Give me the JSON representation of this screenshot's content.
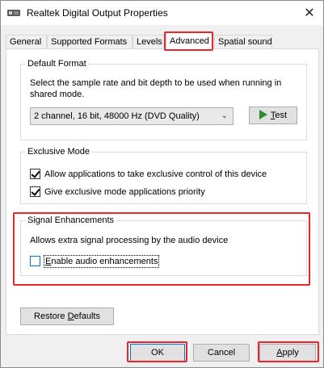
{
  "window": {
    "title": "Realtek Digital Output Properties",
    "close_glyph": "✕"
  },
  "tabs": [
    {
      "label": "General"
    },
    {
      "label": "Supported Formats"
    },
    {
      "label": "Levels"
    },
    {
      "label": "Advanced"
    },
    {
      "label": "Spatial sound"
    }
  ],
  "active_tab": "Advanced",
  "default_format": {
    "title": "Default Format",
    "description": "Select the sample rate and bit depth to be used when running in shared mode.",
    "selected_format": "2 channel, 16 bit, 48000 Hz (DVD Quality)",
    "test_button_prefix": "",
    "test_button_accel": "T",
    "test_button_rest": "est"
  },
  "exclusive_mode": {
    "title": "Exclusive Mode",
    "allow_exclusive_label": "Allow applications to take exclusive control of this device",
    "allow_exclusive_checked": true,
    "priority_label": "Give exclusive mode applications priority",
    "priority_checked": true
  },
  "signal_enhancements": {
    "title": "Signal Enhancements",
    "description": "Allows extra signal processing by the audio device",
    "enable_label_accel": "E",
    "enable_label_rest": "nable audio enhancements",
    "enable_checked": false
  },
  "restore_defaults": {
    "label_start": "Restore ",
    "label_accel": "D",
    "label_end": "efaults"
  },
  "footer": {
    "ok_label": "OK",
    "cancel_label": "Cancel",
    "apply_accel": "A",
    "apply_rest": "pply"
  },
  "colors": {
    "highlight": "#e8262b",
    "accent": "#0078d7",
    "test_icon": "#2e8b2e"
  },
  "icons": {
    "title": "speaker-device-icon",
    "close": "close-icon",
    "dropdown": "chevron-down-icon",
    "test": "play-icon"
  }
}
